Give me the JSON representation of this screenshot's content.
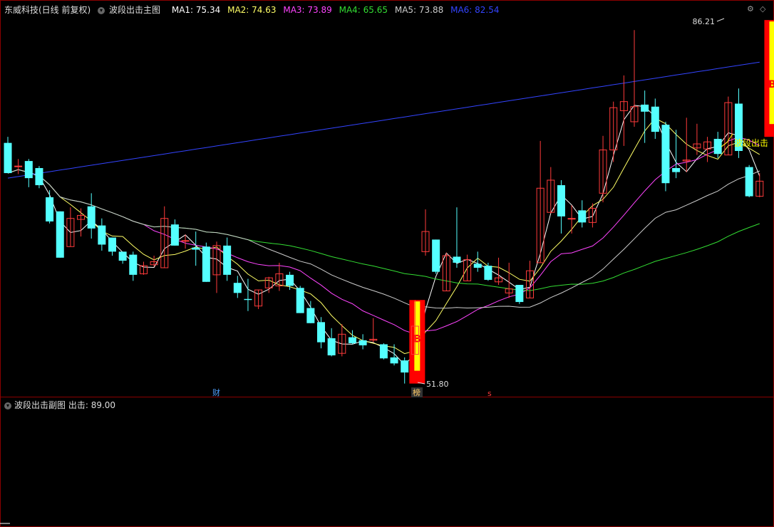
{
  "main_legend": {
    "stock": "东威科技(日线 前复权)",
    "indicator": "波段出击主图",
    "ma1": "MA1: 75.34",
    "ma2": "MA2: 74.63",
    "ma3": "MA3: 73.89",
    "ma4": "MA4: 65.65",
    "ma5": "MA5: 73.88",
    "ma6": "MA6: 82.54"
  },
  "sub_legend": {
    "indicator": "波段出击副图",
    "value": "出击: 89.00"
  },
  "controls": {
    "settings_icon": "gear-icon",
    "diamond_icon": "diamond-icon"
  },
  "markers": {
    "high_label": "86.21",
    "low_label": "51.80",
    "buy_label_1": "B",
    "buy_label_2": "B",
    "signal_text": "波段出击",
    "event_cai": "财",
    "event_bang": "榜",
    "event_s": "s"
  },
  "colors": {
    "up": "#ff3b3b",
    "down": "#54ffff",
    "ma1": "#ffffff",
    "ma2": "#ffff66",
    "ma3": "#ff44ff",
    "ma4": "#33dd33",
    "ma5": "#cccccc",
    "ma6": "#3344ff",
    "signal_bar": "#ff0000",
    "signal_core": "#ffff00"
  },
  "chart_data": {
    "type": "candlestick",
    "price_range": [
      51.8,
      86.21
    ],
    "candles": [
      {
        "o": 74,
        "c": 71,
        "h": 74.6,
        "l": 71
      },
      {
        "o": 71.7,
        "c": 71.7,
        "h": 72.4,
        "l": 70.9
      },
      {
        "o": 72.2,
        "c": 70.5,
        "h": 72.4,
        "l": 69.6
      },
      {
        "o": 71.5,
        "c": 69.8,
        "h": 71.7,
        "l": 69.5
      },
      {
        "o": 68.6,
        "c": 66.2,
        "h": 69.3,
        "l": 66
      },
      {
        "o": 67.2,
        "c": 62.6,
        "h": 67.2,
        "l": 62.6
      },
      {
        "o": 63.7,
        "c": 66.5,
        "h": 67.6,
        "l": 63.7
      },
      {
        "o": 66.4,
        "c": 66.8,
        "h": 67.5,
        "l": 64.7
      },
      {
        "o": 67.7,
        "c": 65.5,
        "h": 69,
        "l": 64.5
      },
      {
        "o": 65.8,
        "c": 63.9,
        "h": 66.5,
        "l": 63.3
      },
      {
        "o": 64.6,
        "c": 63.2,
        "h": 64.6,
        "l": 62.8
      },
      {
        "o": 63.2,
        "c": 62.3,
        "h": 63.2,
        "l": 62
      },
      {
        "o": 62.9,
        "c": 60.9,
        "h": 63.2,
        "l": 60.3
      },
      {
        "o": 61,
        "c": 61.8,
        "h": 62.2,
        "l": 60.9
      },
      {
        "o": 61.9,
        "c": 62.2,
        "h": 62.8,
        "l": 61.7
      },
      {
        "o": 61.6,
        "c": 66.5,
        "h": 67.7,
        "l": 61.6
      },
      {
        "o": 65.9,
        "c": 63.8,
        "h": 66.4,
        "l": 63.8
      },
      {
        "o": 64.3,
        "c": 64.3,
        "h": 64.9,
        "l": 63.5
      },
      {
        "o": 63.6,
        "c": 63.4,
        "h": 65.2,
        "l": 61.8
      },
      {
        "o": 63.7,
        "c": 60.2,
        "h": 64.1,
        "l": 60.2
      },
      {
        "o": 60.9,
        "c": 63.8,
        "h": 64.2,
        "l": 59.1
      },
      {
        "o": 63.8,
        "c": 60.9,
        "h": 64.6,
        "l": 60.3
      },
      {
        "o": 60.1,
        "c": 59.1,
        "h": 60.8,
        "l": 58.6
      },
      {
        "o": 58.5,
        "c": 58.4,
        "h": 60.5,
        "l": 57.3
      },
      {
        "o": 57.8,
        "c": 59.4,
        "h": 59.4,
        "l": 57.5
      },
      {
        "o": 59.6,
        "c": 60.6,
        "h": 60.7,
        "l": 59.1
      },
      {
        "o": 59.8,
        "c": 61,
        "h": 62.1,
        "l": 59.3
      },
      {
        "o": 60.9,
        "c": 59.8,
        "h": 61.2,
        "l": 59.4
      },
      {
        "o": 59.6,
        "c": 57.1,
        "h": 59.8,
        "l": 57.1
      },
      {
        "o": 57.6,
        "c": 56.1,
        "h": 58.3,
        "l": 56.1
      },
      {
        "o": 56.2,
        "c": 54.2,
        "h": 56.7,
        "l": 53.6
      },
      {
        "o": 54.6,
        "c": 52.9,
        "h": 55.6,
        "l": 52.8
      },
      {
        "o": 53.1,
        "c": 55,
        "h": 56,
        "l": 52.8
      },
      {
        "o": 54.7,
        "c": 54.1,
        "h": 55.4,
        "l": 54
      },
      {
        "o": 54.4,
        "c": 53.9,
        "h": 55,
        "l": 53.5
      },
      {
        "o": 54.4,
        "c": 54.5,
        "h": 56.6,
        "l": 54.2
      },
      {
        "o": 54,
        "c": 52.6,
        "h": 54.1,
        "l": 52.5
      },
      {
        "o": 52.7,
        "c": 52.1,
        "h": 54,
        "l": 51.9
      },
      {
        "o": 52.4,
        "c": 51.2,
        "h": 52.7,
        "l": 50.1
      },
      {
        "o": 53,
        "c": 55.8,
        "h": 58.4,
        "l": 53
      },
      {
        "o": 63.2,
        "c": 65.2,
        "h": 67.4,
        "l": 62.8
      },
      {
        "o": 64.4,
        "c": 61.2,
        "h": 64.4,
        "l": 61
      },
      {
        "o": 59.3,
        "c": 62.8,
        "h": 63.1,
        "l": 59.3
      },
      {
        "o": 62.7,
        "c": 62.1,
        "h": 67.6,
        "l": 61.6
      },
      {
        "o": 60.3,
        "c": 62.4,
        "h": 62.9,
        "l": 60.3
      },
      {
        "o": 62,
        "c": 61.6,
        "h": 63.2,
        "l": 61.2
      },
      {
        "o": 61.8,
        "c": 60.4,
        "h": 62.1,
        "l": 60.3
      },
      {
        "o": 60.2,
        "c": 60.6,
        "h": 62.6,
        "l": 59.9
      },
      {
        "o": 59.1,
        "c": 59.5,
        "h": 62.1,
        "l": 58.6
      },
      {
        "o": 59.9,
        "c": 58.2,
        "h": 59.9,
        "l": 58
      },
      {
        "o": 58.6,
        "c": 61.3,
        "h": 62.3,
        "l": 58.6
      },
      {
        "o": 62.1,
        "c": 69.5,
        "h": 74.2,
        "l": 62.1
      },
      {
        "o": 67.1,
        "c": 70.3,
        "h": 71.6,
        "l": 67
      },
      {
        "o": 69.8,
        "c": 66.7,
        "h": 70.3,
        "l": 65
      },
      {
        "o": 66.5,
        "c": 66.5,
        "h": 67.8,
        "l": 65
      },
      {
        "o": 67.3,
        "c": 66.1,
        "h": 68.3,
        "l": 65.6
      },
      {
        "o": 66.1,
        "c": 67.5,
        "h": 68,
        "l": 65.6
      },
      {
        "o": 69,
        "c": 73.3,
        "h": 74.7,
        "l": 68.1
      },
      {
        "o": 73.3,
        "c": 77.5,
        "h": 78.1,
        "l": 72.1
      },
      {
        "o": 77.2,
        "c": 78.1,
        "h": 80.7,
        "l": 73.7
      },
      {
        "o": 76.1,
        "c": 77.6,
        "h": 85.2,
        "l": 75.6
      },
      {
        "o": 77.8,
        "c": 77.1,
        "h": 79.2,
        "l": 74
      },
      {
        "o": 77.6,
        "c": 75.1,
        "h": 78.4,
        "l": 74.4
      },
      {
        "o": 75.8,
        "c": 70,
        "h": 76.1,
        "l": 69.2
      },
      {
        "o": 71.5,
        "c": 71.1,
        "h": 75.3,
        "l": 70.5
      },
      {
        "o": 72.2,
        "c": 72.3,
        "h": 76.5,
        "l": 71.1
      },
      {
        "o": 73.5,
        "c": 73.9,
        "h": 75.9,
        "l": 72.8
      },
      {
        "o": 73.4,
        "c": 74.1,
        "h": 74.6,
        "l": 72.1
      },
      {
        "o": 74.4,
        "c": 72.9,
        "h": 75.1,
        "l": 72.5
      },
      {
        "o": 72.8,
        "c": 78,
        "h": 78.6,
        "l": 72.8
      },
      {
        "o": 77.9,
        "c": 73.2,
        "h": 79.4,
        "l": 72.5
      },
      {
        "o": 71.6,
        "c": 68.7,
        "h": 71.8,
        "l": 68.6
      },
      {
        "o": 68.7,
        "c": 70.2,
        "h": 71,
        "l": 68.6
      }
    ],
    "signals": [
      {
        "index": 39,
        "label": "B"
      },
      {
        "index": 73,
        "label": "B"
      }
    ],
    "sub_chart": {
      "series_name": "出击",
      "peak_value": 89.0,
      "spikes_at": [
        39,
        73
      ]
    }
  }
}
